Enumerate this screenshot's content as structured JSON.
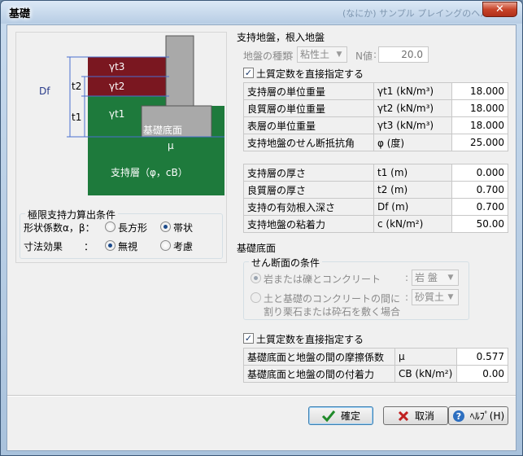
{
  "window": {
    "title": "基礎",
    "ghost_title": "(なにか) サンプル プレイングのヘルプ",
    "close_glyph": "✕"
  },
  "diagram": {
    "labels": {
      "gt3": "γt3",
      "gt2": "γt2",
      "gt1": "γt1",
      "df": "Df",
      "t2": "t2",
      "t1": "t1",
      "base": "基礎底面",
      "mu": "μ",
      "support": "支持層（φ，cB）"
    },
    "colors": {
      "red": "#7a1720",
      "green": "#1e7a3c",
      "gray": "#a9a9a9",
      "line": "#4a6fd0"
    }
  },
  "limit": {
    "title": "極限支持力算出条件",
    "shape_label": "形状係数α，β：",
    "shape_options": [
      "長方形",
      "帯状"
    ],
    "shape_selected": 1,
    "dim_label": "寸法効果",
    "dim_colon": "：",
    "dim_options": [
      "無視",
      "考慮"
    ],
    "dim_selected": 0
  },
  "support": {
    "title": "支持地盤，根入地盤",
    "soil_type_label": "地盤の種類",
    "soil_type_value": "粘性土",
    "n_label": "N値",
    "n_value": "20.0",
    "direct_check_label": "土質定数を直接指定する",
    "direct_checked": true,
    "table1": [
      {
        "name": "支持層の単位重量",
        "sym": "γt1 (kN/m³)",
        "value": "18.000"
      },
      {
        "name": "良質層の単位重量",
        "sym": "γt2 (kN/m³)",
        "value": "18.000"
      },
      {
        "name": "表層の単位重量",
        "sym": "γt3 (kN/m³)",
        "value": "18.000"
      },
      {
        "name": "支持地盤のせん断抵抗角",
        "sym": "φ  (度)",
        "value": "25.000"
      }
    ],
    "table2": [
      {
        "name": "支持層の厚さ",
        "sym": "t1  (m)",
        "value": "0.000"
      },
      {
        "name": "良質層の厚さ",
        "sym": "t2  (m)",
        "value": "0.700"
      },
      {
        "name": "支持の有効根入深さ",
        "sym": "Df  (m)",
        "value": "0.700"
      },
      {
        "name": "支持地盤の粘着力",
        "sym": "c  (kN/m²)",
        "value": "50.00"
      }
    ]
  },
  "base": {
    "title": "基礎底面",
    "shear_title": "せん断面の条件",
    "opt1_label": "岩または礫とコンクリート",
    "opt1_combo": "岩 盤",
    "opt2_label": "土と基礎のコンクリートの間に",
    "opt2_sub": "割り栗石または砕石を敷く場合",
    "opt2_combo": "砂質土",
    "colon": ":",
    "direct_check_label": "土質定数を直接指定する",
    "direct_checked": true,
    "table": [
      {
        "name": "基礎底面と地盤の間の摩擦係数",
        "sym": "μ",
        "value": "0.577"
      },
      {
        "name": "基礎底面と地盤の間の付着力",
        "sym": "CB (kN/m²)",
        "value": "0.00"
      }
    ]
  },
  "buttons": {
    "ok": "確定",
    "cancel": "取消",
    "help": "ﾍﾙﾌﾟ(H)"
  }
}
